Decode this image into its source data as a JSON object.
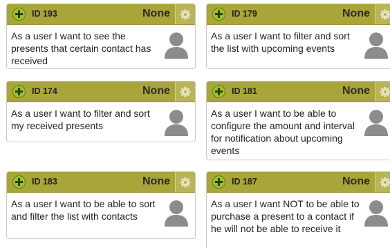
{
  "cards": [
    {
      "id": "ID 193",
      "status": "None",
      "text": "As a user I want to see the presents that certain contact has received"
    },
    {
      "id": "ID 179",
      "status": "None",
      "text": "As a user I want to filter and sort the list with upcoming events"
    },
    {
      "id": "ID 174",
      "status": "None",
      "text": "As a user I want to filter and sort my received presents"
    },
    {
      "id": "ID 181",
      "status": "None",
      "text": "As a user I want to be able to configure the amount and interval for notification about upcoming events"
    },
    {
      "id": "ID 183",
      "status": "None",
      "text": "As a user I want to be able to sort and filter the list with contacts"
    },
    {
      "id": "ID 187",
      "status": "None",
      "text": "As a user I want NOT to be able to purchase a present to a contact if he will not be able to receive it"
    }
  ],
  "icons": {
    "expand": "plus-circle-icon",
    "settings": "gear-icon",
    "assignee": "user-avatar-icon"
  },
  "colors": {
    "header": "#aaa53a",
    "expand": "#9bc02c",
    "avatar": "#8c8c8c"
  }
}
